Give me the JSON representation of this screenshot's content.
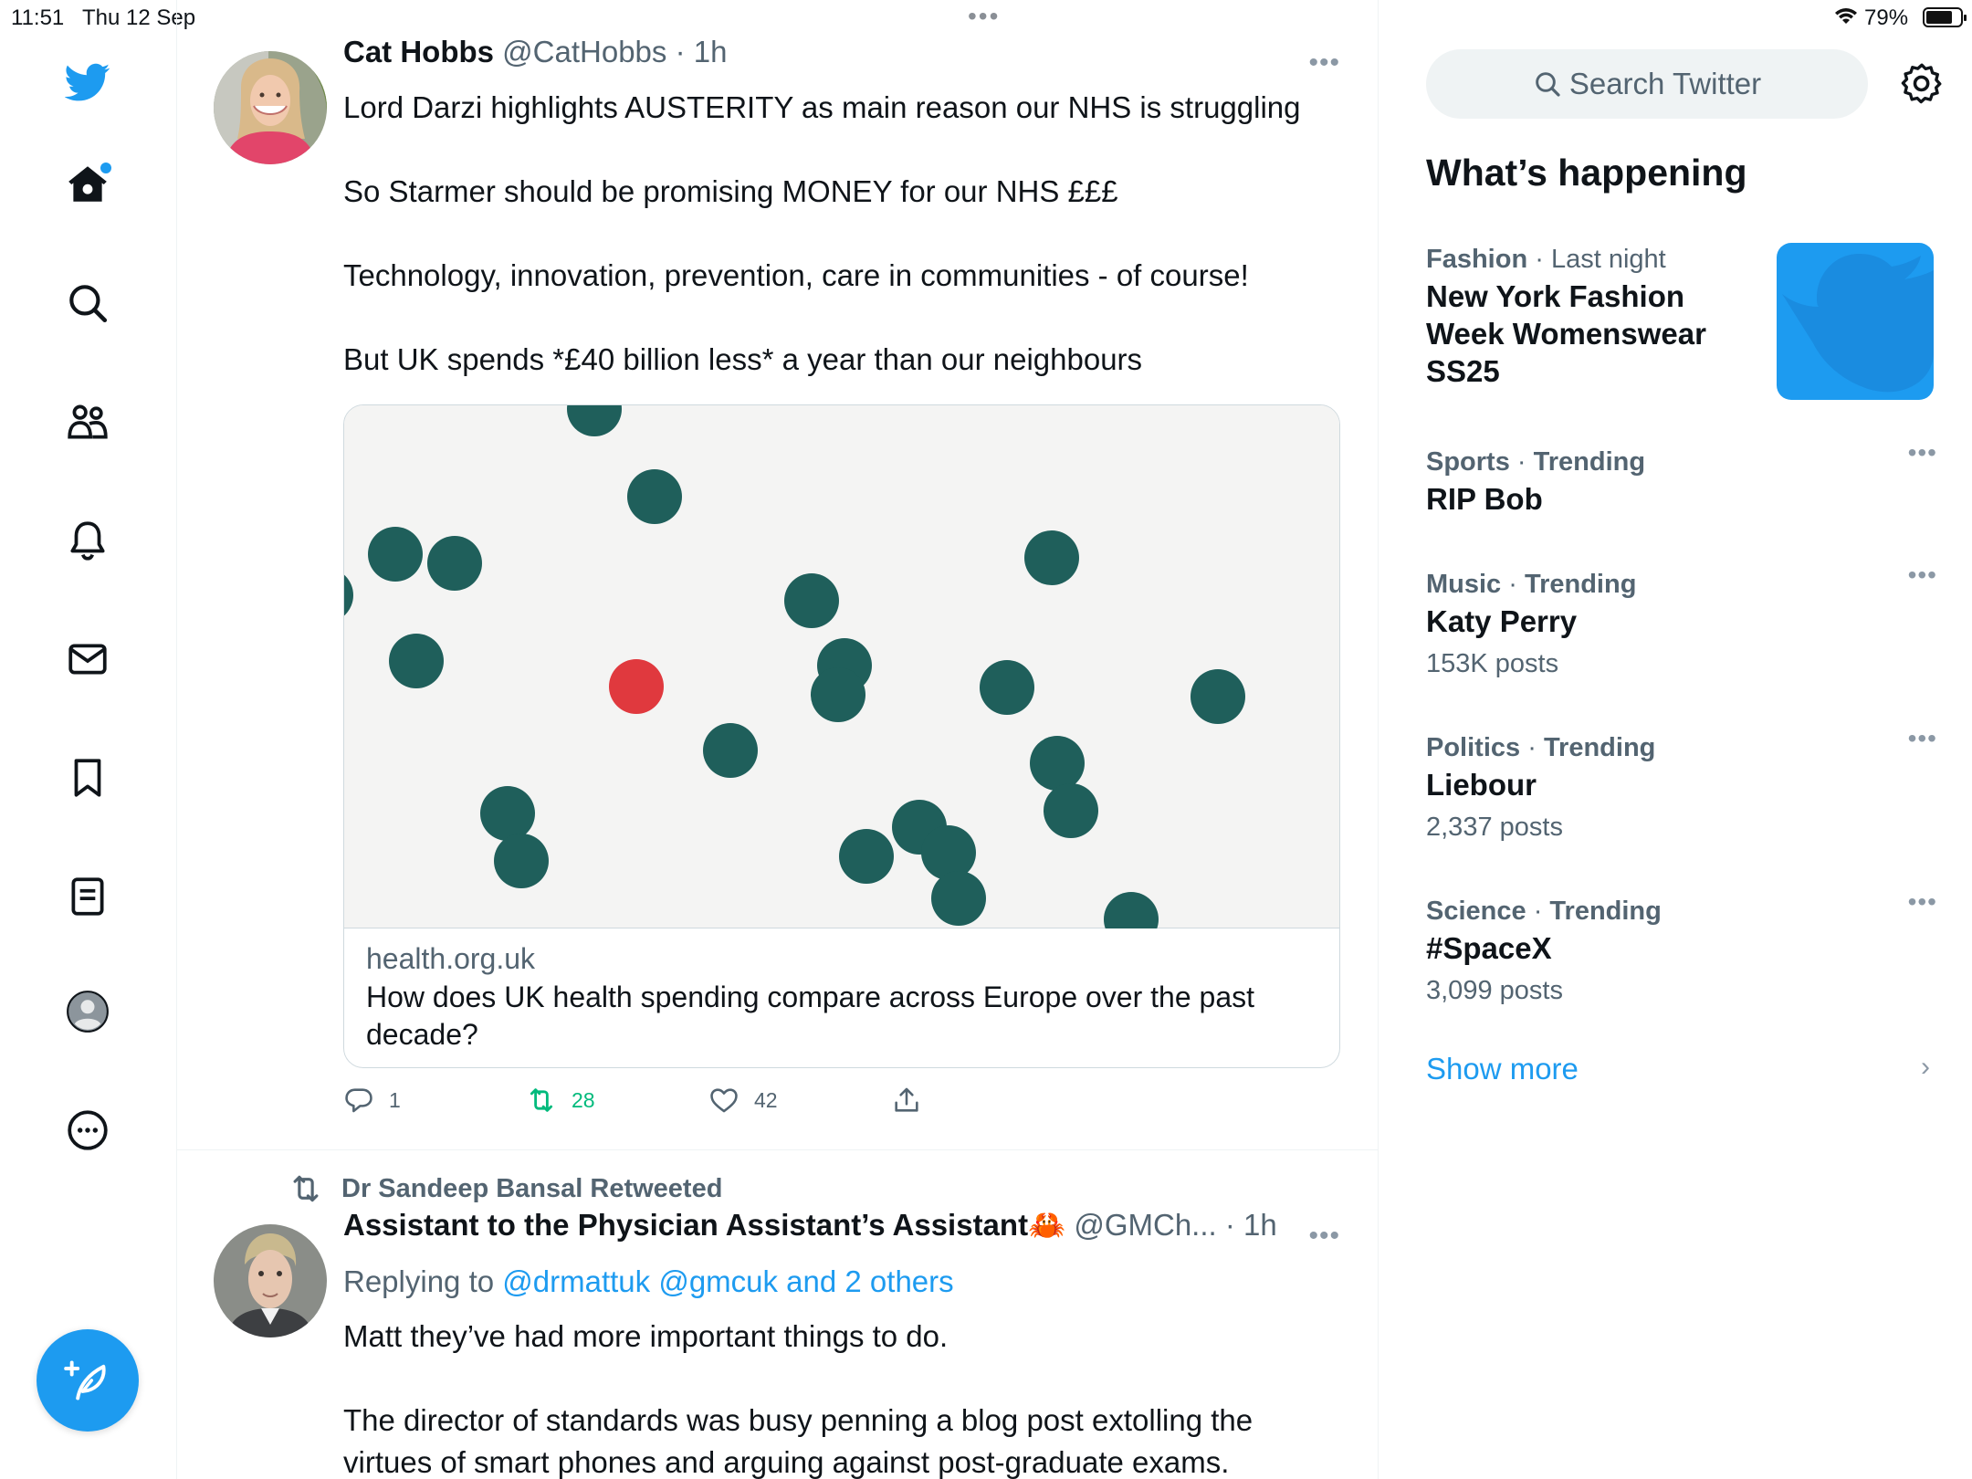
{
  "status_bar": {
    "time": "11:51",
    "date": "Thu 12 Sep",
    "battery": "79%",
    "battery_level": 0.79
  },
  "nav": {
    "items": [
      "twitter-logo",
      "home",
      "explore",
      "communities",
      "notifications",
      "messages",
      "bookmarks",
      "lists",
      "profile",
      "more"
    ],
    "compose_icon": "compose-feather-icon",
    "accent_color": "#1d9bf0"
  },
  "tweets": [
    {
      "name": "Cat Hobbs",
      "handle": "@CatHobbs",
      "time": "1h",
      "paragraphs": [
        "Lord Darzi highlights AUSTERITY as main reason our NHS is struggling",
        "So Starmer should be promising MONEY for our NHS £££",
        "Technology, innovation, prevention, care in communities - of course!",
        "But UK spends *£40 billion less* a year than our neighbours"
      ],
      "card": {
        "domain": "health.org.uk",
        "title": "How does UK health spending compare across Europe over the past decade?"
      },
      "replies": "1",
      "retweets": "28",
      "likes": "42"
    },
    {
      "retweeted_by": "Dr Sandeep Bansal Retweeted",
      "name": "Assistant to the Physician Assistant’s Assistant🦀",
      "handle": "@GMCh...",
      "time": "1h",
      "replying_prefix": "Replying to",
      "replying_to": "@drmattuk @gmcuk and 2 others",
      "paragraphs": [
        "Matt they’ve had more important things to do.",
        "The director of standards was busy penning a blog post extolling the virtues of smart phones and arguing against post-graduate exams."
      ]
    }
  ],
  "sidebar": {
    "search_placeholder": "Search Twitter",
    "heading": "What’s happening",
    "trends": [
      {
        "category": "Fashion",
        "meta": "Last night",
        "title": "New York Fashion Week Womenswear SS25",
        "count": ""
      },
      {
        "category": "Sports",
        "meta": "Trending",
        "title": "RIP Bob",
        "count": ""
      },
      {
        "category": "Music",
        "meta": "Trending",
        "title": "Katy Perry",
        "count": "153K posts"
      },
      {
        "category": "Politics",
        "meta": "Trending",
        "title": "Liebour",
        "count": "2,337 posts"
      },
      {
        "category": "Science",
        "meta": "Trending",
        "title": "#SpaceX",
        "count": "3,099 posts"
      }
    ],
    "show_more": "Show more"
  }
}
